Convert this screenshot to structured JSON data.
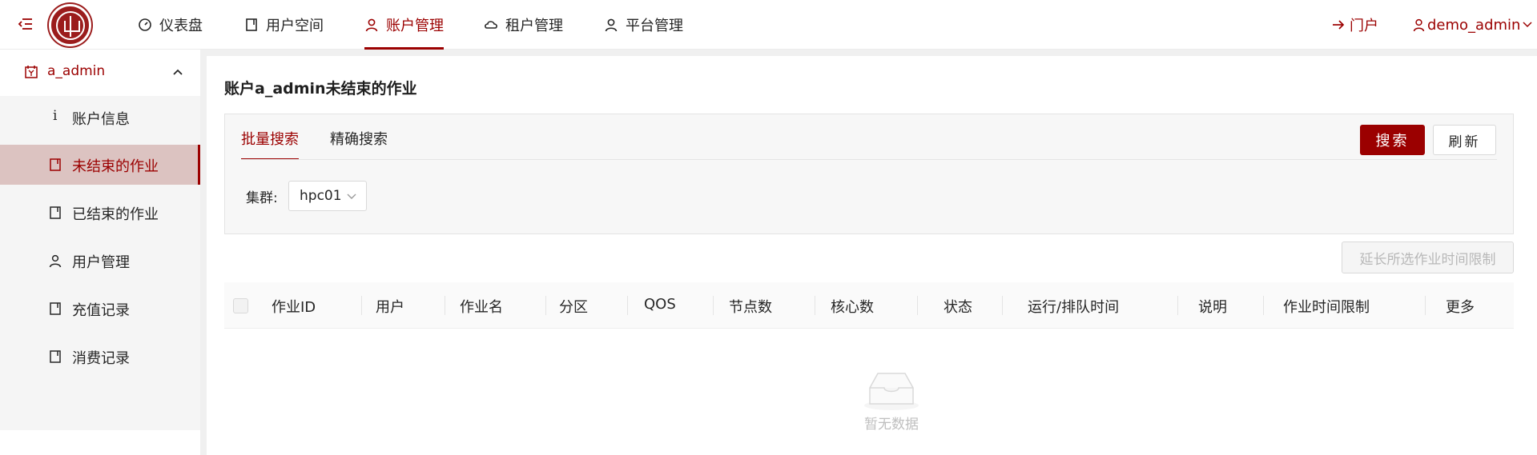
{
  "header": {
    "nav": [
      {
        "label": "仪表盘",
        "icon": "dashboard-icon"
      },
      {
        "label": "用户空间",
        "icon": "book-icon"
      },
      {
        "label": "账户管理",
        "icon": "user-icon"
      },
      {
        "label": "租户管理",
        "icon": "cloud-icon"
      },
      {
        "label": "平台管理",
        "icon": "user-icon"
      }
    ],
    "active_nav": "账户管理",
    "portal_label": "门户",
    "username": "demo_admin"
  },
  "sidebar": {
    "group_label": "a_admin",
    "items": [
      {
        "label": "账户信息",
        "icon": "info-icon"
      },
      {
        "label": "未结束的作业",
        "icon": "book-icon"
      },
      {
        "label": "已结束的作业",
        "icon": "book-icon"
      },
      {
        "label": "用户管理",
        "icon": "user-icon"
      },
      {
        "label": "充值记录",
        "icon": "book-icon"
      },
      {
        "label": "消费记录",
        "icon": "book-icon"
      }
    ],
    "active_item": "未结束的作业"
  },
  "main": {
    "title": "账户a_admin未结束的作业",
    "tabs": [
      "批量搜索",
      "精确搜索"
    ],
    "active_tab": "批量搜索",
    "search_label": "搜索",
    "refresh_label": "刷新",
    "cluster_label": "集群:",
    "cluster_value": "hpc01",
    "extend_label": "延长所选作业时间限制",
    "columns": [
      "作业ID",
      "用户",
      "作业名",
      "分区",
      "QOS",
      "节点数",
      "核心数",
      "状态",
      "运行/排队时间",
      "说明",
      "作业时间限制",
      "更多"
    ],
    "empty_text": "暂无数据"
  },
  "colors": {
    "accent": "#9b0000",
    "active_bg": "#dcc3c1",
    "page_bg": "#f0f0f0"
  }
}
